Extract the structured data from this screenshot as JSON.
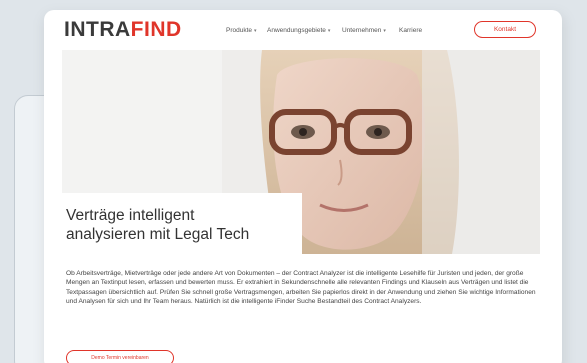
{
  "brand": {
    "logo_main": "INTRA",
    "logo_accent": "FIND",
    "accent_color": "#e0352a"
  },
  "nav": {
    "items": [
      {
        "label": "Produkte",
        "dropdown": true
      },
      {
        "label": "Anwendungsgebiete",
        "dropdown": true
      },
      {
        "label": "Unternehmen",
        "dropdown": true
      },
      {
        "label": "Karriere",
        "dropdown": false
      }
    ],
    "contact_label": "Kontakt"
  },
  "hero": {
    "headline_line1": "Verträge intelligent",
    "headline_line2": "analysieren mit Legal Tech"
  },
  "body": {
    "text": "Ob Arbeitsverträge, Mietverträge oder jede andere Art von Dokumenten – der Contract Analyzer ist die intelligente Lesehilfe für Juristen und jeden, der große Mengen an Textinput lesen, erfassen und bewerten muss. Er extrahiert in Sekundenschnelle alle relevanten Findings und Klauseln aus Verträgen und listet die Textpassagen übersichtlich auf. Prüfen Sie schnell große Vertragsmengen, arbeiten Sie papierlos direkt in der Anwendung und ziehen Sie wichtige Informationen und Analysen für sich und Ihr Team heraus. Natürlich ist die intelligente iFinder Suche Bestandteil des Contract Analyzers."
  },
  "cta": {
    "demo_label": "Demo Termin vereinbaren"
  },
  "icons": {
    "dropdown": "chevron-down-icon"
  }
}
